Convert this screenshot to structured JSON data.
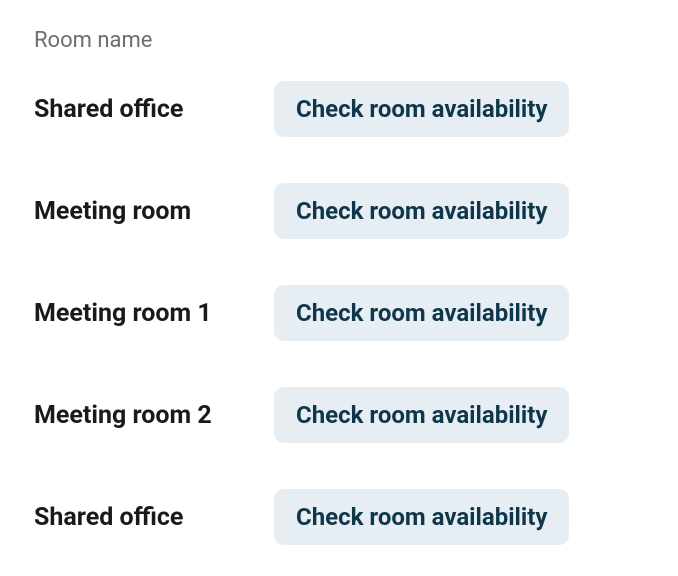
{
  "header": {
    "column_label": "Room name"
  },
  "rooms": [
    {
      "name": "Shared office",
      "button_label": "Check room availability"
    },
    {
      "name": "Meeting room",
      "button_label": "Check room availability"
    },
    {
      "name": "Meeting room 1",
      "button_label": "Check room availability"
    },
    {
      "name": "Meeting room 2",
      "button_label": "Check room availability"
    },
    {
      "name": "Shared office",
      "button_label": "Check room availability"
    }
  ],
  "colors": {
    "button_bg": "#e6eef3",
    "button_text": "#10364b",
    "header_text": "#6e6e6e",
    "name_text": "#1a1a1a"
  }
}
